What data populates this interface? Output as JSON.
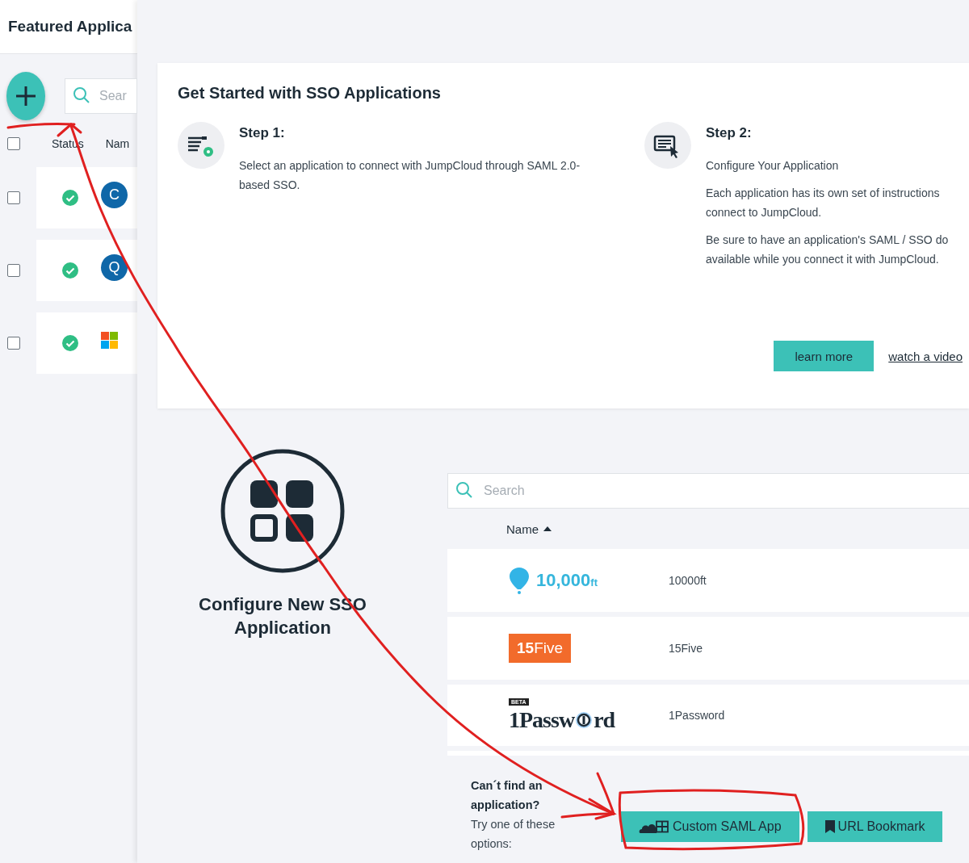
{
  "background_page": {
    "title": "Featured Applica",
    "search": {
      "placeholder": "Sear"
    },
    "all_checked": false,
    "columns": [
      "Status",
      "Nam"
    ],
    "rows": [
      {
        "checked": false,
        "avatar": {
          "kind": "letter",
          "text": "C"
        }
      },
      {
        "checked": false,
        "avatar": {
          "kind": "letter",
          "text": "Q"
        }
      },
      {
        "checked": false,
        "avatar": {
          "kind": "windows"
        }
      }
    ]
  },
  "panel": {
    "get_started": {
      "title": "Get Started with SSO Applications",
      "steps": [
        {
          "title": "Step 1:",
          "paragraphs": [
            [
              "Select an application to connect with JumpCloud through SAML 2.0-",
              "based SSO."
            ]
          ]
        },
        {
          "title": "Step 2:",
          "paragraphs": [
            [
              "Configure Your Application"
            ],
            [
              "Each application has its own set of instructions",
              "connect to JumpCloud."
            ],
            [
              "Be sure to have an application's SAML / SSO do",
              "available while you connect it with JumpCloud."
            ]
          ]
        }
      ],
      "learn_more": "learn more",
      "watch_video": "watch a video"
    },
    "configure": {
      "title": "Configure New SSO Application"
    },
    "catalog": {
      "search": {
        "placeholder": "Search"
      },
      "column": "Name",
      "apps": [
        {
          "logo": {
            "kind": "balloon",
            "text": "10,000",
            "suffix": "ft"
          },
          "name": "10000ft"
        },
        {
          "logo": {
            "kind": "orange-box",
            "text": "15",
            "suffix": "Five"
          },
          "name": "15Five"
        },
        {
          "logo": {
            "kind": "serif",
            "badge": "BETA",
            "text": "1Passw",
            "keyhole": true,
            "suffix": "rd"
          },
          "name": "1Password"
        }
      ]
    },
    "footer": {
      "question": "Can´t find an application?",
      "hint": "Try one of these options:",
      "buttons": [
        {
          "kind": "saml",
          "label": "Custom SAML App"
        },
        {
          "kind": "bookmark",
          "label": "URL Bookmark"
        }
      ]
    }
  },
  "annotation": {
    "kind": "red-arrow"
  }
}
